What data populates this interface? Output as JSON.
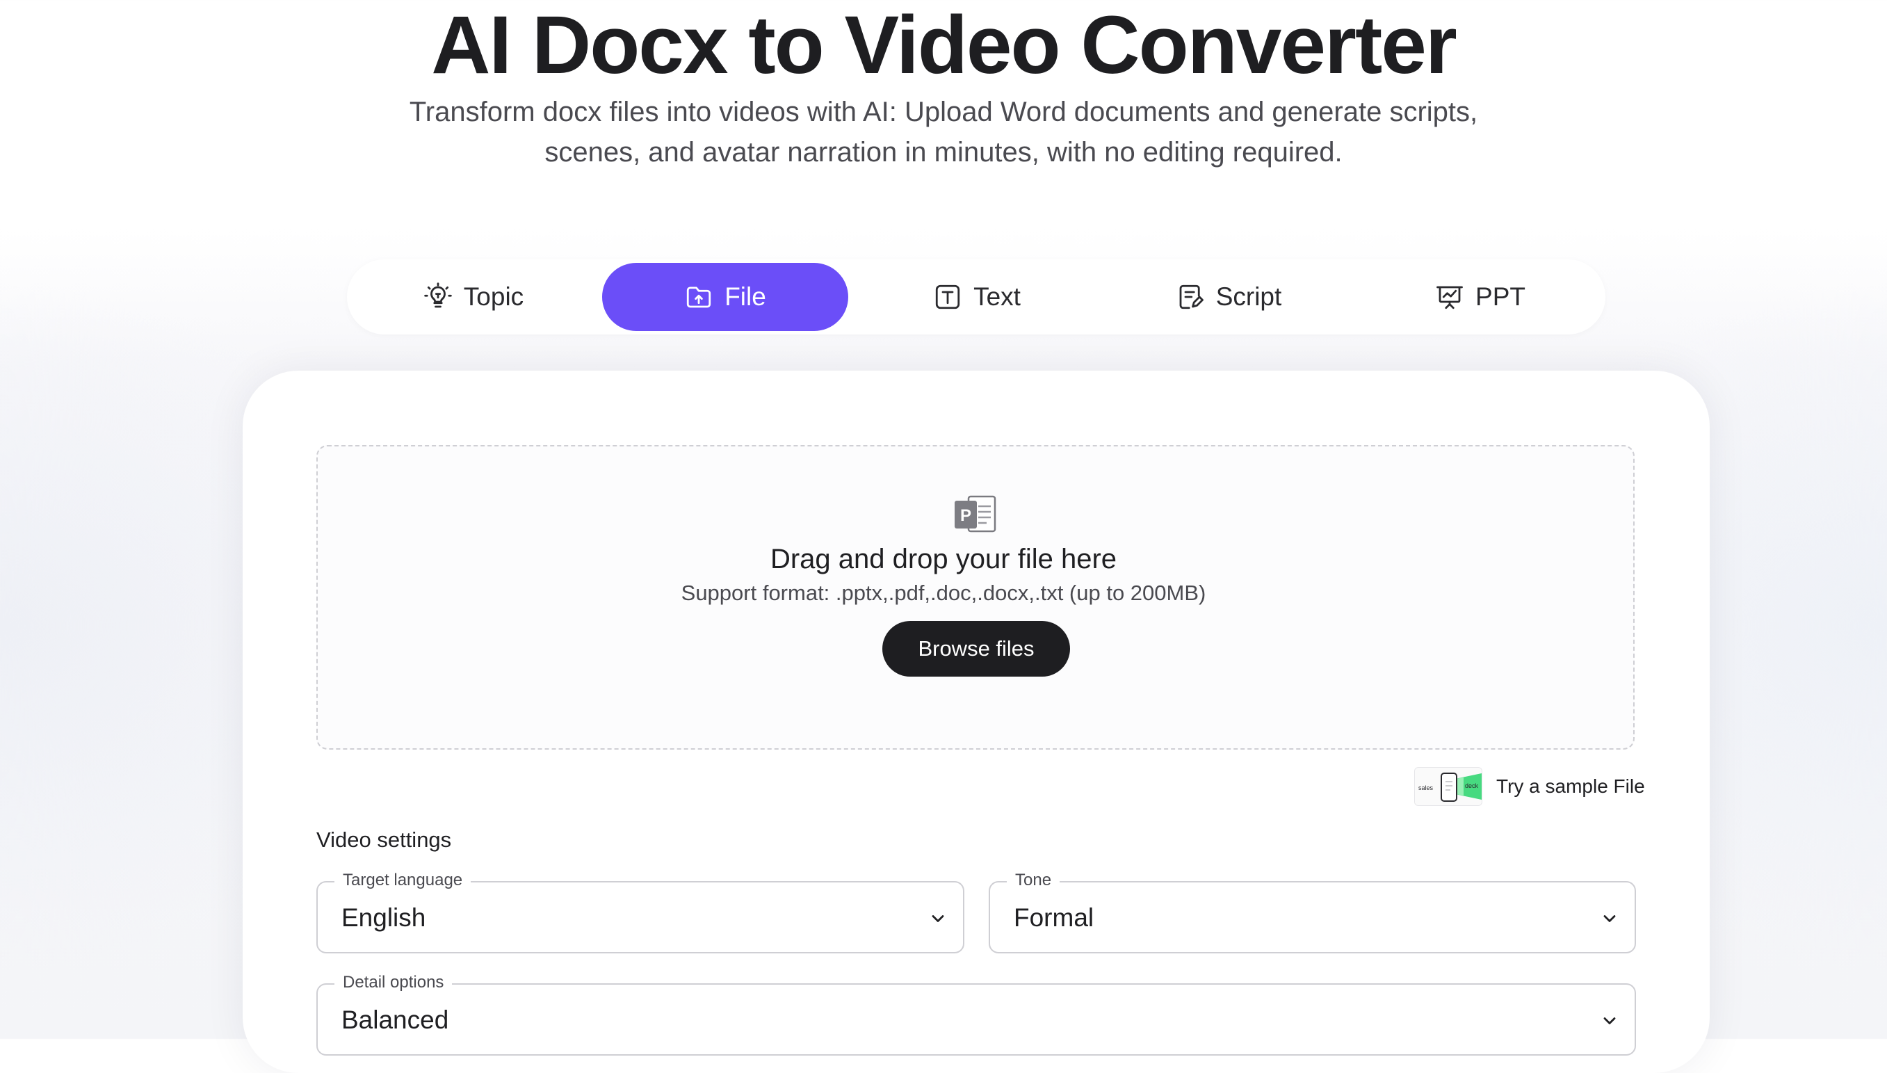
{
  "header": {
    "title": "AI Docx to Video Converter",
    "subtitle": "Transform docx files into videos with AI: Upload Word documents and generate scripts, scenes, and avatar narration in minutes, with no editing required."
  },
  "tabs": [
    {
      "label": "Topic",
      "icon": "lightbulb-icon"
    },
    {
      "label": "File",
      "icon": "folder-upload-icon",
      "active": true
    },
    {
      "label": "Text",
      "icon": "text-box-icon"
    },
    {
      "label": "Script",
      "icon": "script-edit-icon"
    },
    {
      "label": "PPT",
      "icon": "presentation-icon"
    }
  ],
  "upload": {
    "title": "Drag and drop your file here",
    "support": "Support format: .pptx,.pdf,.doc,.docx,.txt (up to 200MB)",
    "browse_label": "Browse files",
    "icon": "powerpoint-file-icon"
  },
  "sample": {
    "label": "Try a sample File",
    "thumb_left": "sales",
    "thumb_right": "deck"
  },
  "settings": {
    "title": "Video settings",
    "target_language": {
      "label": "Target language",
      "value": "English"
    },
    "tone": {
      "label": "Tone",
      "value": "Formal"
    },
    "detail": {
      "label": "Detail options",
      "value": "Balanced"
    }
  },
  "colors": {
    "accent": "#6b4ef8",
    "button_dark": "#1e1e21"
  }
}
